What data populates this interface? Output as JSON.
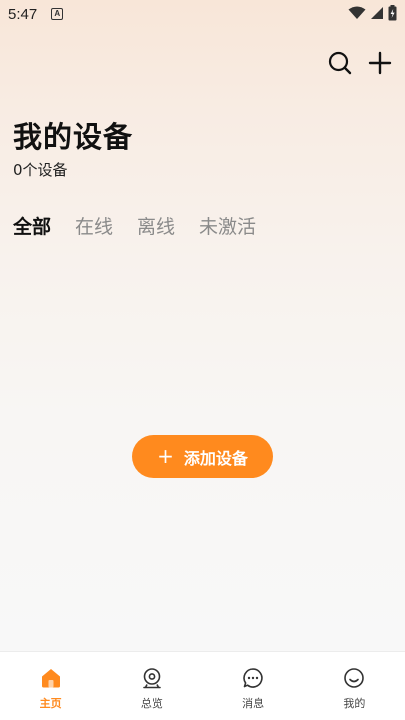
{
  "status_bar": {
    "time": "5:47",
    "notification_glyph": "A"
  },
  "header": {
    "title": "我的设备",
    "device_count": "0个设备",
    "actions": [
      {
        "name": "search-icon"
      },
      {
        "name": "plus-icon"
      }
    ]
  },
  "tabs": [
    {
      "label": "全部",
      "active": true
    },
    {
      "label": "在线",
      "active": false
    },
    {
      "label": "离线",
      "active": false
    },
    {
      "label": "未激活",
      "active": false
    }
  ],
  "empty_state": {
    "add_button_label": "添加设备",
    "add_button_icon": "+"
  },
  "bottom_nav": [
    {
      "label": "主页",
      "icon": "home-icon",
      "active": true
    },
    {
      "label": "总览",
      "icon": "overview-icon",
      "active": false
    },
    {
      "label": "消息",
      "icon": "message-icon",
      "active": false
    },
    {
      "label": "我的",
      "icon": "profile-icon",
      "active": false
    }
  ],
  "colors": {
    "accent": "#ff8a1e",
    "text": "#111111",
    "muted": "#8a8a8a"
  }
}
